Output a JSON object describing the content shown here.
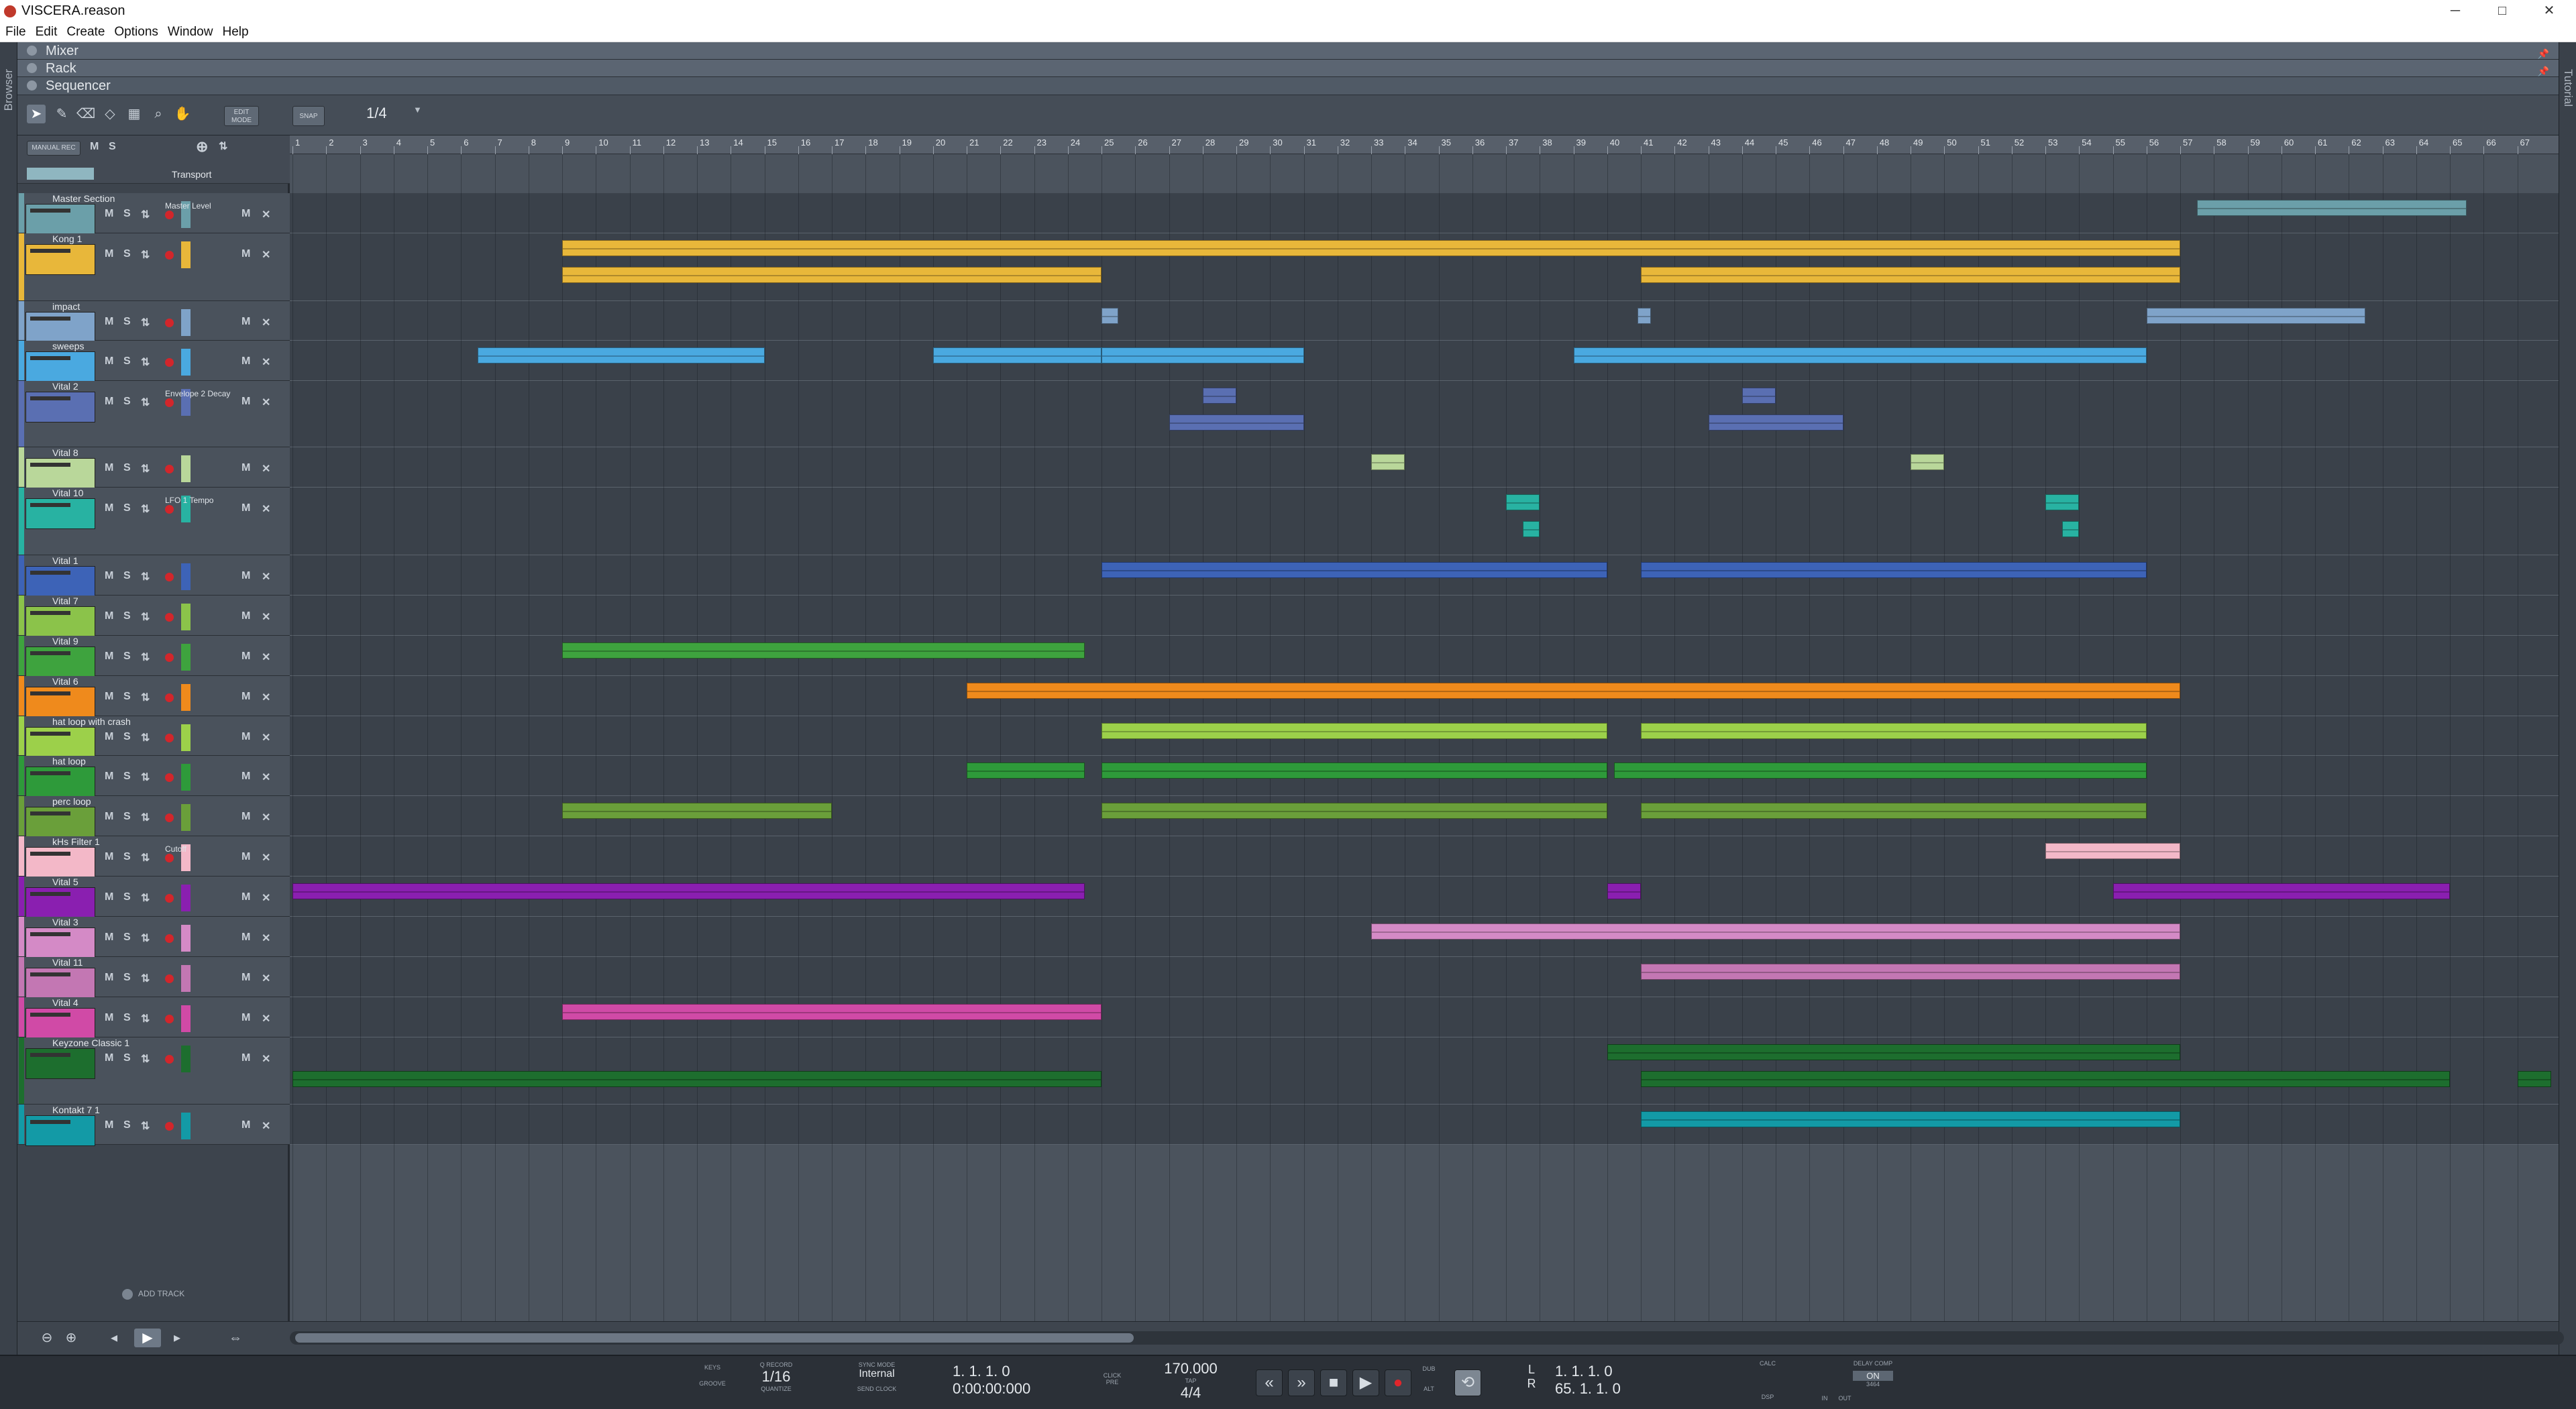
{
  "window": {
    "title": "VISCERA.reason",
    "minimize": "─",
    "maximize": "□",
    "close": "✕"
  },
  "menu": [
    "File",
    "Edit",
    "Create",
    "Options",
    "Window",
    "Help"
  ],
  "side": {
    "left": "Browser",
    "right": "Tutorial"
  },
  "sections": {
    "mixer": "Mixer",
    "rack": "Rack",
    "sequencer": "Sequencer"
  },
  "toolbar": {
    "edit_mode": "EDIT MODE",
    "snap": "SNAP",
    "snap_value": "1/4"
  },
  "header": {
    "manual_rec": "MANUAL REC",
    "m": "M",
    "s": "S",
    "transport": "Transport",
    "add_track": "ADD TRACK"
  },
  "tracks": [
    {
      "name": "Master Section",
      "color": "#6b9fa9",
      "lane": "Master Level"
    },
    {
      "name": "Kong 1",
      "color": "#e8b73a",
      "lane": ""
    },
    {
      "name": "impact",
      "color": "#7fa3c9",
      "lane": ""
    },
    {
      "name": "sweeps",
      "color": "#4aa9e0",
      "lane": ""
    },
    {
      "name": "Vital 2",
      "color": "#5a6fb2",
      "lane": "Envelope 2 Decay"
    },
    {
      "name": "Vital 8",
      "color": "#b9d79a",
      "lane": ""
    },
    {
      "name": "Vital 10",
      "color": "#28b2a2",
      "lane": "LFO 1 Tempo"
    },
    {
      "name": "Vital 1",
      "color": "#3d63b7",
      "lane": ""
    },
    {
      "name": "Vital 7",
      "color": "#8bc34a",
      "lane": ""
    },
    {
      "name": "Vital 9",
      "color": "#3ea33e",
      "lane": ""
    },
    {
      "name": "Vital 6",
      "color": "#ef8a1c",
      "lane": ""
    },
    {
      "name": "hat loop with crash",
      "color": "#9cd04a",
      "lane": ""
    },
    {
      "name": "hat loop",
      "color": "#2e9a3a",
      "lane": ""
    },
    {
      "name": "perc loop",
      "color": "#6a9f3a",
      "lane": ""
    },
    {
      "name": "kHs Filter 1",
      "color": "#f3b8c8",
      "lane": "Cutoff"
    },
    {
      "name": "Vital 5",
      "color": "#8a1fb0",
      "lane": ""
    },
    {
      "name": "Vital 3",
      "color": "#d48ac6",
      "lane": ""
    },
    {
      "name": "Vital 11",
      "color": "#c377b3",
      "lane": ""
    },
    {
      "name": "Vital 4",
      "color": "#d04aa6",
      "lane": ""
    },
    {
      "name": "Keyzone Classic 1",
      "color": "#1d6e2e",
      "lane": ""
    },
    {
      "name": "Kontakt 7 1",
      "color": "#139aa6",
      "lane": ""
    }
  ],
  "ruler": [
    "1",
    "2",
    "3",
    "4",
    "5",
    "6",
    "7",
    "8",
    "9",
    "10",
    "11",
    "12",
    "13",
    "14",
    "15",
    "16",
    "17",
    "18",
    "19",
    "20",
    "21",
    "22",
    "23",
    "24",
    "25",
    "26",
    "27",
    "28",
    "29",
    "30",
    "31",
    "32",
    "33",
    "34",
    "35",
    "36",
    "37",
    "38",
    "39",
    "40",
    "41",
    "42",
    "43",
    "44",
    "45",
    "46",
    "47",
    "48",
    "49",
    "50",
    "51",
    "52",
    "53",
    "54",
    "55",
    "56",
    "57",
    "58",
    "59",
    "60",
    "61",
    "62",
    "63",
    "64",
    "65",
    "66",
    "67"
  ],
  "transport": {
    "keys": "KEYS",
    "groove": "GROOVE",
    "q_record": "Q RECORD",
    "quantize_value": "1/16",
    "quantize": "QUANTIZE",
    "sync_mode": "SYNC MODE",
    "sync_value": "Internal",
    "send_clock": "SEND CLOCK",
    "position": "1. 1. 1.   0",
    "time": "0:00:00:000",
    "click": "CLICK",
    "pre": "PRE",
    "tempo": "170.000",
    "tap": "TAP",
    "signature": "4/4",
    "dub": "DUB",
    "alt": "ALT",
    "loop_l_label": "L",
    "loop_l": "1. 1. 1.   0",
    "loop_r_label": "R",
    "loop_r": "65. 1. 1.   0",
    "dsp": "DSP",
    "in": "IN",
    "out": "OUT",
    "calc": "CALC",
    "delay_comp": "DELAY COMP",
    "on": "ON",
    "delay_value": "3464"
  }
}
